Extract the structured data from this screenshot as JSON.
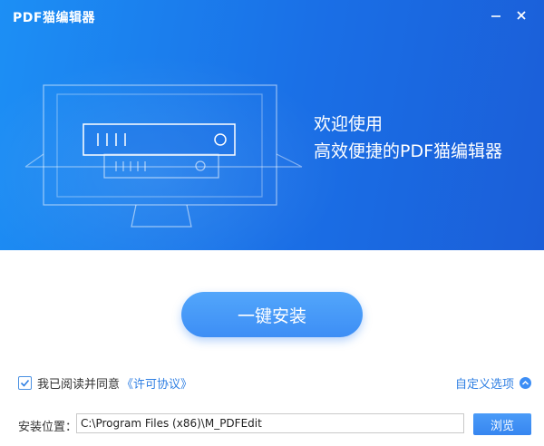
{
  "window": {
    "title": "PDF猫编辑器",
    "minimize_icon": "minimize-icon",
    "close_icon": "close-icon"
  },
  "banner": {
    "headline_line1": "欢迎使用",
    "headline_line2": "高效便捷的PDF猫编辑器",
    "illustration": "server-monitor-illustration"
  },
  "install": {
    "button_label": "一键安装"
  },
  "agreement": {
    "checked": true,
    "text": "我已阅读并同意",
    "link_text": "《许可协议》"
  },
  "custom_options": {
    "label": "自定义选项",
    "icon": "chevron-up-icon"
  },
  "install_path": {
    "label": "安装位置：",
    "value": "C:\\Program Files (x86)\\M_PDFEdit",
    "browse_label": "浏览"
  },
  "colors": {
    "banner_start": "#1c8ff5",
    "banner_end": "#1b5ed8",
    "accent": "#3d8ef5",
    "link": "#2f7fe3"
  }
}
